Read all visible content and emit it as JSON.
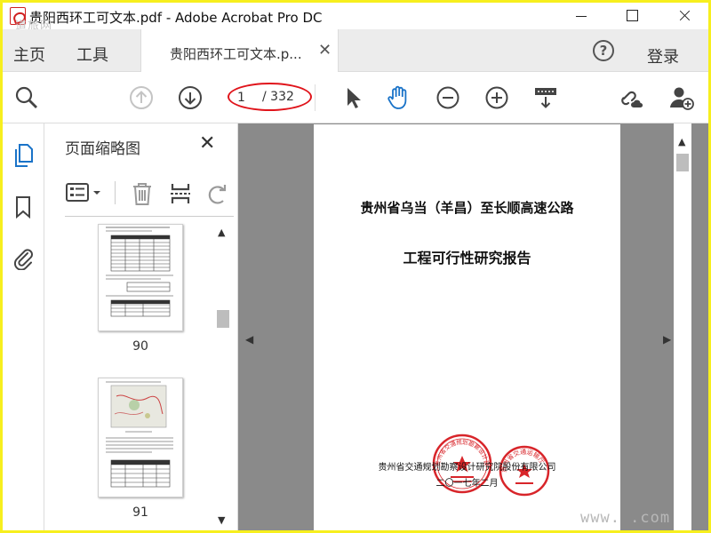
{
  "window": {
    "title": "贵阳西环工可文本.pdf - Adobe Acrobat Pro DC",
    "watermark_tl": "道旅网"
  },
  "menu": {
    "home": "主页",
    "tools": "工具",
    "doc_tab": "贵阳西环工可文本.p...",
    "sign_in": "登录"
  },
  "toolbar": {
    "current_page": "1",
    "total_pages": "/ 332",
    "highlight_color": "#e0141b"
  },
  "thumbnails_panel": {
    "title": "页面缩略图",
    "pages": [
      {
        "label": "90"
      },
      {
        "label": "91"
      }
    ]
  },
  "document": {
    "title_line1": "贵州省乌当（羊昌）至长顺高速公路",
    "title_line2": "工程可行性研究报告",
    "organization": "贵州省交通规划勘察设计研究院股份有限公司",
    "date": "二〇一七年二月",
    "seal_color": "#d8252a",
    "seal1_text": "贵州省交通规划勘察设计研究院股份有限公司",
    "seal2_text": "贵州省交通运输厅"
  },
  "watermark_br": "www.      .com",
  "colors": {
    "frame": "#f7ef1e",
    "hand_tool_active": "#1a73c8",
    "doc_background": "#8a8a8a"
  }
}
